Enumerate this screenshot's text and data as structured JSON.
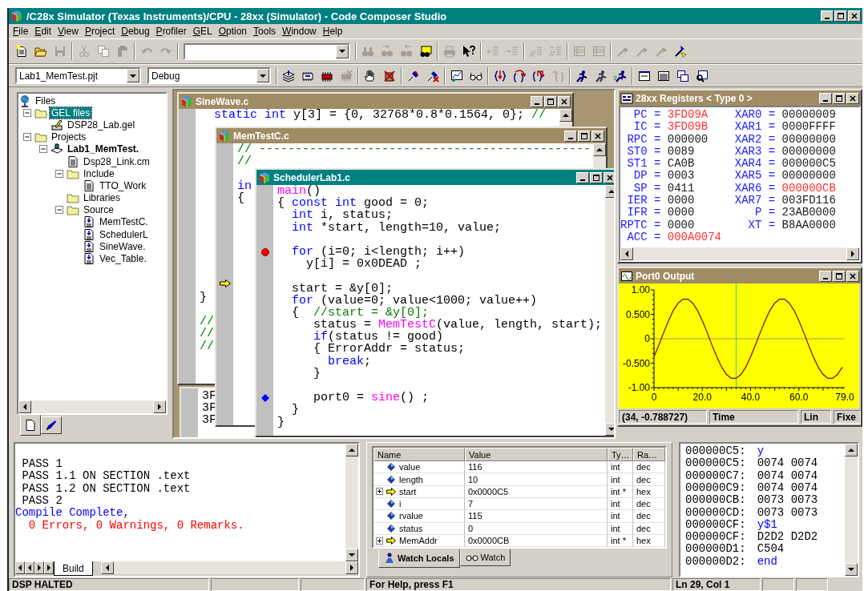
{
  "app": {
    "title": "/C28x Simulator (Texas Instruments)/CPU - 28xx (Simulator) - Code Composer Studio"
  },
  "menu": [
    "File",
    "Edit",
    "View",
    "Project",
    "Debug",
    "Profiler",
    "GEL",
    "Option",
    "Tools",
    "Window",
    "Help"
  ],
  "toolbars": [
    {
      "items": [
        {
          "kind": "new",
          "disabled": false
        },
        {
          "kind": "open",
          "disabled": false
        },
        {
          "kind": "save",
          "disabled": true
        },
        {
          "kind": "separator"
        },
        {
          "kind": "cut",
          "disabled": true
        },
        {
          "kind": "copy",
          "disabled": true
        },
        {
          "kind": "paste",
          "disabled": true
        },
        {
          "kind": "separator"
        },
        {
          "kind": "undo",
          "disabled": true
        },
        {
          "kind": "redo",
          "disabled": true
        },
        {
          "kind": "separator"
        },
        {
          "kind": "combo"
        },
        {
          "kind": "separator"
        },
        {
          "kind": "find",
          "disabled": true
        },
        {
          "kind": "find-next",
          "disabled": true
        },
        {
          "kind": "find-prev",
          "disabled": true
        },
        {
          "kind": "find-files",
          "disabled": false
        },
        {
          "kind": "separator"
        },
        {
          "kind": "print",
          "disabled": true
        },
        {
          "kind": "help",
          "disabled": false
        },
        {
          "kind": "separator"
        },
        {
          "kind": "outdent",
          "disabled": true
        },
        {
          "kind": "indent",
          "disabled": true
        },
        {
          "kind": "separator"
        },
        {
          "kind": "comment",
          "disabled": true
        },
        {
          "kind": "uncomment",
          "disabled": true
        },
        {
          "kind": "separator"
        },
        {
          "kind": "list",
          "disabled": true
        },
        {
          "kind": "list",
          "disabled": true
        },
        {
          "kind": "separator"
        },
        {
          "kind": "flag",
          "disabled": true
        },
        {
          "kind": "flag",
          "disabled": true
        },
        {
          "kind": "flag",
          "disabled": true
        },
        {
          "kind": "flag-go",
          "disabled": false
        }
      ]
    },
    {
      "items": [
        {
          "kind": "combo",
          "value": "Lab1_MemTest.pjt"
        },
        {
          "kind": "combo",
          "value": "Debug"
        },
        {
          "kind": "separator"
        },
        {
          "kind": "stack",
          "disabled": false
        },
        {
          "kind": "chip",
          "disabled": false
        },
        {
          "kind": "chip-red",
          "disabled": false
        },
        {
          "kind": "chip-x",
          "disabled": true
        },
        {
          "kind": "separator"
        },
        {
          "kind": "hand",
          "disabled": false
        },
        {
          "kind": "bp-x",
          "disabled": false
        },
        {
          "kind": "separator"
        },
        {
          "kind": "pin",
          "disabled": false
        },
        {
          "kind": "pin-x",
          "disabled": false
        },
        {
          "kind": "separator"
        },
        {
          "kind": "graph",
          "disabled": false
        },
        {
          "kind": "glasses",
          "disabled": false
        },
        {
          "kind": "separator"
        },
        {
          "kind": "step-into",
          "disabled": false
        },
        {
          "kind": "step-over",
          "disabled": false
        },
        {
          "kind": "step-out",
          "disabled": false
        },
        {
          "kind": "run-cursor",
          "disabled": true
        },
        {
          "kind": "separator"
        },
        {
          "kind": "run",
          "disabled": false
        },
        {
          "kind": "run",
          "disabled": true
        },
        {
          "kind": "animate",
          "disabled": false
        },
        {
          "kind": "separator"
        },
        {
          "kind": "memory-window",
          "disabled": false
        },
        {
          "kind": "register-window",
          "disabled": false
        },
        {
          "kind": "windows",
          "disabled": false
        },
        {
          "kind": "inspect-window",
          "disabled": false
        }
      ]
    }
  ],
  "tree": {
    "items": [
      {
        "label": "Files",
        "kind": "root",
        "selected": false,
        "children": [
          {
            "label": "GEL files",
            "kind": "folder",
            "expanded": true,
            "selected": true,
            "children": [
              {
                "label": "DSP28_Lab.gel",
                "kind": "gel",
                "selected": false
              }
            ]
          },
          {
            "label": "Projects",
            "kind": "folder",
            "expanded": true,
            "selected": false,
            "children": [
              {
                "label": "Lab1_MemTest.",
                "kind": "project",
                "expanded": true,
                "selected": false,
                "children": [
                  {
                    "label": "Dsp28_Link.cm",
                    "kind": "document",
                    "selected": false
                  },
                  {
                    "label": "Include",
                    "kind": "folder",
                    "expanded": true,
                    "selected": false,
                    "children": [
                      {
                        "label": "TTO_Work",
                        "kind": "document",
                        "selected": false
                      }
                    ]
                  },
                  {
                    "label": "Libraries",
                    "kind": "folder",
                    "selected": false
                  },
                  {
                    "label": "Source",
                    "kind": "folder",
                    "expanded": true,
                    "selected": false,
                    "children": [
                      {
                        "label": "MemTestC.",
                        "kind": "source",
                        "selected": false
                      },
                      {
                        "label": "SchedulerL",
                        "kind": "source",
                        "selected": false
                      },
                      {
                        "label": "SineWave.",
                        "kind": "source",
                        "selected": false
                      },
                      {
                        "label": "Vec_Table.",
                        "kind": "source",
                        "selected": false
                      }
                    ]
                  }
                ]
              }
            ]
          }
        ]
      }
    ],
    "tabs": [
      {
        "kind": "files",
        "selected": true
      },
      {
        "kind": "bookmarks",
        "selected": false
      }
    ]
  },
  "editor_windows": [
    {
      "title": "SineWave.c",
      "active": false,
      "lines": [
        {
          "kind": "code",
          "parts": [
            {
              "kind": "keyword",
              "text": "  static int"
            },
            {
              "kind": "plain",
              "text": " y[3] = {0, 32768*0.8*0.1564, 0}; "
            },
            {
              "kind": "comment",
              "text": "//"
            }
          ]
        },
        {
          "kind": "blank"
        },
        {
          "kind": "blank"
        },
        {
          "kind": "blank"
        },
        {
          "kind": "blank"
        },
        {
          "kind": "blank"
        },
        {
          "kind": "blank"
        },
        {
          "kind": "blank"
        },
        {
          "kind": "blank"
        },
        {
          "kind": "blank"
        },
        {
          "kind": "blank"
        },
        {
          "kind": "blank"
        },
        {
          "kind": "blank"
        },
        {
          "kind": "blank"
        },
        {
          "kind": "blank"
        },
        {
          "kind": "code",
          "parts": [
            {
              "kind": "plain",
              "text": "}"
            }
          ]
        },
        {
          "kind": "blank"
        },
        {
          "kind": "code",
          "parts": [
            {
              "kind": "comment",
              "text": "//"
            }
          ]
        },
        {
          "kind": "code",
          "parts": [
            {
              "kind": "comment",
              "text": "//"
            }
          ]
        },
        {
          "kind": "code",
          "parts": [
            {
              "kind": "comment",
              "text": "//"
            }
          ]
        }
      ]
    },
    {
      "title": "MemTestC.c",
      "active": false,
      "lines": [
        {
          "kind": "code",
          "parts": [
            {
              "kind": "comment",
              "text": "// ----------------------------------------------"
            }
          ]
        },
        {
          "kind": "code",
          "parts": [
            {
              "kind": "comment",
              "text": "//"
            }
          ]
        },
        {
          "kind": "blank"
        },
        {
          "kind": "code",
          "parts": [
            {
              "kind": "keyword",
              "text": "in"
            }
          ]
        },
        {
          "kind": "code",
          "parts": [
            {
              "kind": "plain",
              "text": "{"
            }
          ]
        },
        {
          "kind": "blank"
        },
        {
          "kind": "blank"
        },
        {
          "kind": "blank"
        },
        {
          "kind": "blank"
        },
        {
          "kind": "blank"
        },
        {
          "kind": "blank"
        },
        {
          "kind": "pc"
        }
      ]
    },
    {
      "title": "SchedulerLab1.c",
      "active": true,
      "lines": [
        {
          "kind": "code",
          "parts": [
            {
              "kind": "call",
              "text": "main"
            },
            {
              "kind": "plain",
              "text": "()"
            }
          ]
        },
        {
          "kind": "code",
          "parts": [
            {
              "kind": "plain",
              "text": "{ "
            },
            {
              "kind": "keyword",
              "text": "const int"
            },
            {
              "kind": "plain",
              "text": " good = 0;"
            }
          ]
        },
        {
          "kind": "code",
          "parts": [
            {
              "kind": "keyword",
              "text": "  int"
            },
            {
              "kind": "plain",
              "text": " i, status;"
            }
          ]
        },
        {
          "kind": "code",
          "parts": [
            {
              "kind": "keyword",
              "text": "  int"
            },
            {
              "kind": "plain",
              "text": " *start, length=10, value;"
            }
          ]
        },
        {
          "kind": "blank"
        },
        {
          "kind": "breakpoint",
          "parts": [
            {
              "kind": "keyword",
              "text": "  for"
            },
            {
              "kind": "plain",
              "text": " (i=0; i<length; i++)"
            }
          ]
        },
        {
          "kind": "code",
          "parts": [
            {
              "kind": "plain",
              "text": "    y[i] = 0x0DEAD ;"
            }
          ]
        },
        {
          "kind": "blank"
        },
        {
          "kind": "code",
          "parts": [
            {
              "kind": "plain",
              "text": "  start = &y[0];"
            }
          ]
        },
        {
          "kind": "code",
          "parts": [
            {
              "kind": "keyword",
              "text": "  for"
            },
            {
              "kind": "plain",
              "text": " (value=0; value<1000; value++)"
            }
          ]
        },
        {
          "kind": "code",
          "parts": [
            {
              "kind": "plain",
              "text": "  {  "
            },
            {
              "kind": "comment",
              "text": "//start = &y[0];"
            }
          ]
        },
        {
          "kind": "code",
          "parts": [
            {
              "kind": "plain",
              "text": "     status = "
            },
            {
              "kind": "call",
              "text": "MemTestC"
            },
            {
              "kind": "plain",
              "text": "(value, length, start);"
            }
          ]
        },
        {
          "kind": "code",
          "parts": [
            {
              "kind": "keyword",
              "text": "     if"
            },
            {
              "kind": "plain",
              "text": "(status != good)"
            }
          ]
        },
        {
          "kind": "code",
          "parts": [
            {
              "kind": "plain",
              "text": "     { ErrorAddr = status;"
            }
          ]
        },
        {
          "kind": "code",
          "parts": [
            {
              "kind": "keyword",
              "text": "       break"
            },
            {
              "kind": "plain",
              "text": ";"
            }
          ]
        },
        {
          "kind": "code",
          "parts": [
            {
              "kind": "plain",
              "text": "     }"
            }
          ]
        },
        {
          "kind": "blank"
        },
        {
          "kind": "probe",
          "parts": [
            {
              "kind": "plain",
              "text": "     port0 = "
            },
            {
              "kind": "call",
              "text": "sine"
            },
            {
              "kind": "plain",
              "text": "() ;"
            }
          ]
        },
        {
          "kind": "code",
          "parts": [
            {
              "kind": "plain",
              "text": "  }"
            }
          ]
        },
        {
          "kind": "code",
          "parts": [
            {
              "kind": "plain",
              "text": "}"
            }
          ]
        }
      ]
    }
  ],
  "disassembly": {
    "lines": [
      "3F",
      "3F",
      "3F"
    ]
  },
  "registers": {
    "title": "28xx Registers < Type 0 >",
    "left": [
      {
        "name": "PC",
        "sep": "=",
        "value": "3FD09A",
        "changed": true
      },
      {
        "name": "IC",
        "sep": "=",
        "value": "3FD09B",
        "changed": true
      },
      {
        "name": "RPC",
        "sep": "=",
        "value": "000000",
        "changed": false
      },
      {
        "name": "ST0",
        "sep": "=",
        "value": "0089",
        "changed": false
      },
      {
        "name": "ST1",
        "sep": "=",
        "value": "CA0B",
        "changed": false
      },
      {
        "name": "DP",
        "sep": "=",
        "value": "0003",
        "changed": false
      },
      {
        "name": "SP",
        "sep": "=",
        "value": "0411",
        "changed": false
      },
      {
        "name": "IER",
        "sep": "=",
        "value": "0000",
        "changed": false
      },
      {
        "name": "IFR",
        "sep": "=",
        "value": "0000",
        "changed": false
      },
      {
        "name": "RPTC",
        "sep": "=",
        "value": "0000",
        "changed": false
      },
      {
        "name": "ACC",
        "sep": "=",
        "value": "000A0074",
        "changed": true
      }
    ],
    "right": [
      {
        "name": "XAR0",
        "sep": "=",
        "value": "00000009",
        "changed": false
      },
      {
        "name": "XAR1",
        "sep": "=",
        "value": "0000FFFF",
        "changed": false
      },
      {
        "name": "XAR2",
        "sep": "=",
        "value": "00000000",
        "changed": false
      },
      {
        "name": "XAR3",
        "sep": "=",
        "value": "00000000",
        "changed": false
      },
      {
        "name": "XAR4",
        "sep": "=",
        "value": "000000C5",
        "changed": false
      },
      {
        "name": "XAR5",
        "sep": "=",
        "value": "00000000",
        "changed": false
      },
      {
        "name": "XAR6",
        "sep": "=",
        "value": "000000CB",
        "changed": true
      },
      {
        "name": "XAR7",
        "sep": "=",
        "value": "003FD116",
        "changed": false
      },
      {
        "name": "P",
        "sep": "=",
        "value": "23AB0000",
        "changed": false
      },
      {
        "name": "XT",
        "sep": "=",
        "value": "B8AA0000",
        "changed": false
      }
    ]
  },
  "graph": {
    "title": "Port0 Output",
    "chart_data": {
      "type": "line",
      "x": [
        0,
        2,
        4,
        6,
        8,
        10,
        12,
        14,
        16,
        18,
        20,
        22,
        24,
        26,
        28,
        30,
        32,
        34,
        36,
        38,
        40,
        42,
        44,
        46,
        48,
        50,
        52,
        54,
        56,
        58,
        60,
        62,
        64,
        66,
        68,
        70,
        72,
        74,
        76,
        78
      ],
      "series": [
        {
          "color": "#800000",
          "values": [
            -0.37,
            -0.13,
            0.13,
            0.37,
            0.58,
            0.73,
            0.81,
            0.81,
            0.73,
            0.58,
            0.37,
            0.13,
            -0.13,
            -0.37,
            -0.58,
            -0.73,
            -0.81,
            -0.81,
            -0.73,
            -0.58,
            -0.37,
            -0.13,
            0.13,
            0.37,
            0.58,
            0.73,
            0.81,
            0.81,
            0.73,
            0.58,
            0.37,
            0.13,
            -0.13,
            -0.37,
            -0.58,
            -0.73,
            -0.81,
            -0.81,
            -0.73,
            -0.58
          ]
        }
      ],
      "xlim": [
        0,
        79
      ],
      "ylim": [
        -1,
        1
      ],
      "ref_lines": [
        {
          "axis": "y",
          "value": 0,
          "color": "#a0a060"
        },
        {
          "axis": "x",
          "value": 34,
          "color": "#40c0c0"
        }
      ],
      "xticks": [
        {
          "value": 0,
          "label": "0"
        },
        {
          "value": 20,
          "label": "20.0"
        },
        {
          "value": 40,
          "label": "40.0"
        },
        {
          "value": 60,
          "label": "60.0"
        },
        {
          "value": 79,
          "label": "79.0"
        }
      ],
      "yticks": [
        {
          "value": 1,
          "label": "1.00"
        },
        {
          "value": 0.5,
          "label": "0.500"
        },
        {
          "value": 0,
          "label": "0"
        },
        {
          "value": -0.5,
          "label": "-0.500"
        },
        {
          "value": -1,
          "label": "-1.00"
        }
      ]
    },
    "status": [
      "(34, -0.788727)",
      "Time",
      "Lin",
      "Fixe"
    ]
  },
  "build": {
    "lines": [
      {
        "kind": "plain",
        "text": " PASS 1"
      },
      {
        "kind": "plain",
        "text": " PASS 1.1 ON SECTION .text"
      },
      {
        "kind": "plain",
        "text": " PASS 1.2 ON SECTION .text"
      },
      {
        "kind": "plain",
        "text": " PASS 2"
      },
      {
        "kind": "info",
        "text": "Compile Complete,"
      },
      {
        "kind": "error",
        "text": "  0 Errors, 0 Warnings, 0 Remarks."
      }
    ],
    "tabs": [
      {
        "label": "Build",
        "selected": true
      }
    ]
  },
  "watch": {
    "columns": [
      "Name",
      "Value",
      "Ty…",
      "Ra…"
    ],
    "rows": [
      {
        "kind": "scalar",
        "name": "value",
        "value": "116",
        "type": "int",
        "radix": "dec"
      },
      {
        "kind": "scalar",
        "name": "length",
        "value": "10",
        "type": "int",
        "radix": "dec"
      },
      {
        "kind": "pointer",
        "expanded": false,
        "name": "start",
        "value": "0x0000C5",
        "type": "int *",
        "radix": "hex"
      },
      {
        "kind": "scalar",
        "name": "i",
        "value": "7",
        "type": "int",
        "radix": "dec"
      },
      {
        "kind": "scalar",
        "name": "rvalue",
        "value": "115",
        "type": "int",
        "radix": "dec"
      },
      {
        "kind": "scalar",
        "name": "status",
        "value": "0",
        "type": "int",
        "radix": "dec"
      },
      {
        "kind": "pointer",
        "expanded": false,
        "name": "MemAddr",
        "value": "0x0000CB",
        "type": "int *",
        "radix": "hex"
      }
    ],
    "tabs": [
      {
        "label": "Watch Locals",
        "selected": true
      },
      {
        "label": "Watch",
        "selected": false
      }
    ]
  },
  "memory": {
    "rows": [
      {
        "address": "000000C5:",
        "value": "y",
        "kind": "label"
      },
      {
        "address": "000000C5:",
        "value": "0074 0074",
        "kind": "data"
      },
      {
        "address": "000000C7:",
        "value": "0074 0074",
        "kind": "data"
      },
      {
        "address": "000000C9:",
        "value": "0074 0074",
        "kind": "data"
      },
      {
        "address": "000000CB:",
        "value": "0073 0073",
        "kind": "data"
      },
      {
        "address": "000000CD:",
        "value": "0073 0073",
        "kind": "data"
      },
      {
        "address": "000000CF:",
        "value": "y$1",
        "kind": "label"
      },
      {
        "address": "000000CF:",
        "value": "D2D2 D2D2",
        "kind": "data"
      },
      {
        "address": "000000D1:",
        "value": "C504",
        "kind": "data"
      },
      {
        "address": "000000D2:",
        "value": "end",
        "kind": "label"
      }
    ]
  },
  "status_bar": [
    "DSP HALTED",
    "For Help, press F1",
    "Ln 29, Col 1"
  ]
}
